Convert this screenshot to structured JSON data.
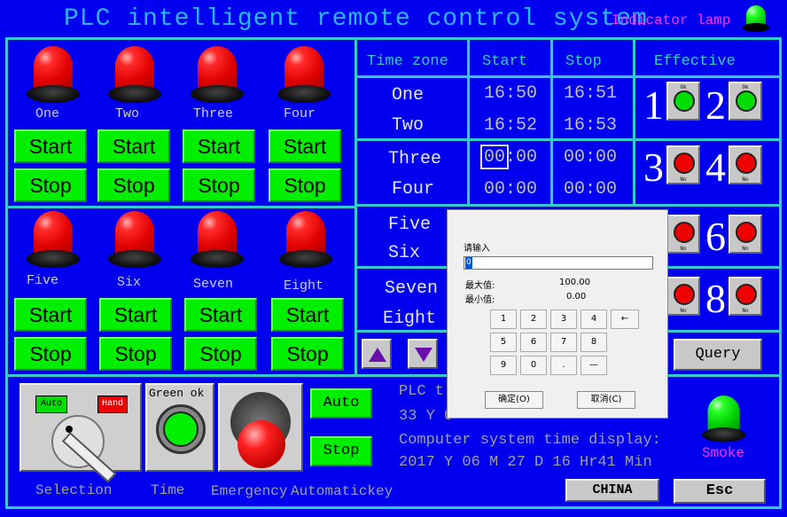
{
  "title": "PLC intelligent remote control system",
  "indicator_lamp_label": "Indicator lamp",
  "lamps_top": [
    "One",
    "Two",
    "Three",
    "Four"
  ],
  "lamps_bottom": [
    "Five",
    "Six",
    "Seven",
    "Eight"
  ],
  "start_label": "Start",
  "stop_label": "Stop",
  "table": {
    "headers": {
      "zone": "Time zone",
      "start": "Start",
      "stop": "Stop",
      "effective": "Effective"
    },
    "rows": [
      {
        "zone": "One",
        "start": "16:50",
        "stop": "16:51"
      },
      {
        "zone": "Two",
        "start": "16:52",
        "stop": "16:53"
      },
      {
        "zone": "Three",
        "start": "00:00",
        "stop": "00:00"
      },
      {
        "zone": "Four",
        "start": "00:00",
        "stop": "00:00"
      },
      {
        "zone": "Five"
      },
      {
        "zone": "Six"
      },
      {
        "zone": "Seven"
      },
      {
        "zone": "Eight"
      }
    ]
  },
  "effective": [
    {
      "num": "1",
      "label": "0k",
      "color": "#00dd00"
    },
    {
      "num": "2",
      "label": "0k",
      "color": "#00dd00"
    },
    {
      "num": "3",
      "label": "No",
      "color": "#ee0000"
    },
    {
      "num": "4",
      "label": "No",
      "color": "#ee0000"
    },
    {
      "num": "6",
      "label": "No",
      "color": "#ee0000"
    },
    {
      "num": "8",
      "label": "No",
      "color": "#ee0000"
    }
  ],
  "hidden_partial_labels": [
    "No",
    "No"
  ],
  "query_label": "Query",
  "selector": {
    "auto": "Auto",
    "hand": "Hand"
  },
  "green_ok_label": "Green ok",
  "auto_button": "Auto",
  "stop_button": "Stop",
  "plc_line1": "PLC t",
  "plc_line2": "33 Y 0",
  "computer_time_label": "Computer system time display:",
  "computer_time_value": "2017 Y 06 M 27 D  16 Hr41 Min",
  "smoke_label": "Smoke",
  "bottom_labels": {
    "selection": "Selection",
    "time": "Time",
    "emergency": "Emergency",
    "automatickey": "Automatickey"
  },
  "china_button": "CHINA",
  "esc_button": "Esc",
  "dialog": {
    "prompt": "请输入",
    "input_value": "0",
    "max_label": "最大值:",
    "max_value": "100.00",
    "min_label": "最小值:",
    "min_value": "0.00",
    "keys": [
      "1",
      "2",
      "3",
      "4",
      "←",
      "5",
      "6",
      "7",
      "8",
      "9",
      "0",
      ".",
      "—"
    ],
    "ok": "确定(O)",
    "cancel": "取消(C)"
  },
  "colors": {
    "background": "#0000ee",
    "grid": "#33cccc",
    "button_green": "#00ee00",
    "lamp_red": "#ee0000",
    "lamp_green": "#00dd00"
  }
}
